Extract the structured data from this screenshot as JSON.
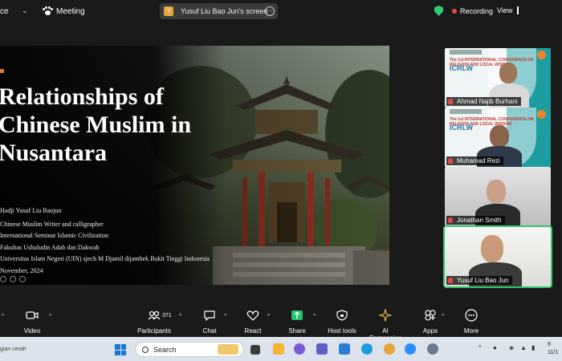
{
  "topbar": {
    "name_fragment": "ce",
    "meeting_label": "Meeting",
    "share_label": "Yusuf Liu Bao Jun's screen",
    "recording_label": "Recording",
    "view_label": "View"
  },
  "slide": {
    "title_lines": [
      "Relationships of",
      "Chinese Muslim in",
      "Nusantara"
    ],
    "info_lines": [
      "Hadji Yusuf Liu Baojun",
      "Chinese Muslim Writer and calligrapher",
      "International Seminar Islamic Civilization",
      "Fakultas Ushuludin Adab dan Dakwah",
      "Universitas Islam Negeri (UIN) sjech M Djamil dijambek Bukit Tinggi Indonesia",
      "November, 2024"
    ]
  },
  "participants": [
    {
      "name": "Ahmad Najib Burhani",
      "banner_line1": "The 1st INTERNATIONAL CONFERENCE ON RELIGION AND LOCAL WISDOM",
      "banner_line2": "ICRLW"
    },
    {
      "name": "Muhamad Rezi",
      "banner_line1": "The 1st INTERNATIONAL CONFERENCE ON RELIGION AND LOCAL WISDOM",
      "banner_line2": "ICRLW"
    },
    {
      "name": "Jonathan Smith"
    },
    {
      "name": "Yusuf Liu Bao Jun"
    }
  ],
  "toolbar": {
    "video_label": "Video",
    "participants_label": "Participants",
    "participants_count": "371",
    "chat_label": "Chat",
    "react_label": "React",
    "share_label": "Share",
    "host_tools_label": "Host tools",
    "ai_label": "AI Companion",
    "apps_label": "Apps",
    "more_label": "More"
  },
  "taskbar": {
    "weather_text": "gian cerah",
    "search_placeholder": "Search",
    "clock_line1": "9",
    "clock_line2": "11/1"
  },
  "colors": {
    "accent_green": "#35c96a",
    "recording_red": "#e74c3c",
    "share_green": "#1ec36b",
    "slide_accent": "#e07b22"
  }
}
